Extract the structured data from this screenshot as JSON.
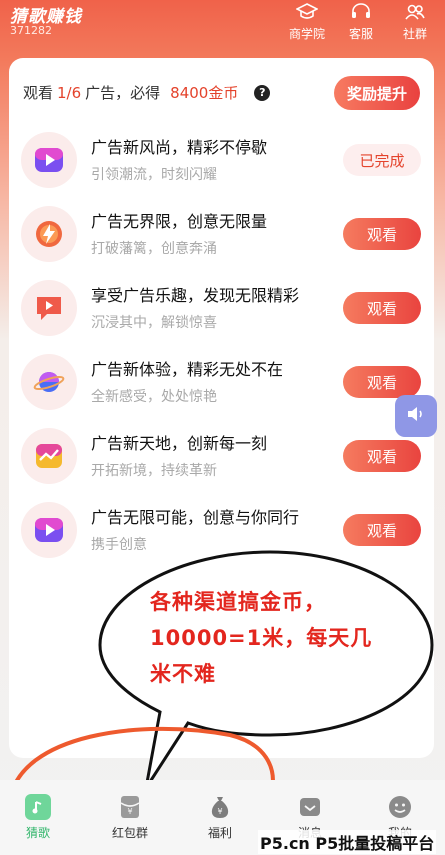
{
  "header": {
    "app_title": "猜歌赚钱",
    "user_id": "371282",
    "nav": [
      {
        "label": "商学院",
        "icon": "graduation-cap-icon"
      },
      {
        "label": "客服",
        "icon": "headset-icon"
      },
      {
        "label": "社群",
        "icon": "community-icon"
      }
    ]
  },
  "summary": {
    "prefix": "观看",
    "progress": "1/6",
    "middle": "广告，必得",
    "reward": "8400金币",
    "help_icon": "?",
    "boost_label": "奖励提升"
  },
  "tasks": [
    {
      "title": "广告新风尚，精彩不停歇",
      "subtitle": "引领潮流，时刻闪耀",
      "button": "已完成",
      "icon": "play-icon",
      "done": true
    },
    {
      "title": "广告无界限，创意无限量",
      "subtitle": "打破藩篱，创意奔涌",
      "button": "观看",
      "icon": "lightning-icon",
      "done": false
    },
    {
      "title": "享受广告乐趣，发现无限精彩",
      "subtitle": "沉浸其中，解锁惊喜",
      "button": "观看",
      "icon": "chat-play-icon",
      "done": false
    },
    {
      "title": "广告新体验，精彩无处不在",
      "subtitle": "全新感受，处处惊艳",
      "button": "观看",
      "icon": "planet-icon",
      "done": false
    },
    {
      "title": "广告新天地，创新每一刻",
      "subtitle": "开拓新境，持续革新",
      "button": "观看",
      "icon": "chart-icon",
      "done": false
    },
    {
      "title": "广告无限可能，创意与你同行",
      "subtitle": "携手创意",
      "button": "观看",
      "icon": "play-icon",
      "done": false
    }
  ],
  "annotation": {
    "text": "各种渠道搞金币，10000=1米，每天几米不难",
    "color": "#e3261e"
  },
  "bottom_nav": [
    {
      "label": "猜歌",
      "icon": "music-note-icon",
      "active": true
    },
    {
      "label": "红包群",
      "icon": "red-packet-icon",
      "active": false
    },
    {
      "label": "福利",
      "icon": "money-bag-icon",
      "active": false
    },
    {
      "label": "消息",
      "icon": "message-icon",
      "active": false
    },
    {
      "label": "我的",
      "icon": "profile-icon",
      "active": false
    }
  ],
  "watermark": "P5.cn P5批量投稿平台",
  "colors": {
    "accent": "#e9443f",
    "active_tab": "#33b66c",
    "header": "#f0624a"
  }
}
